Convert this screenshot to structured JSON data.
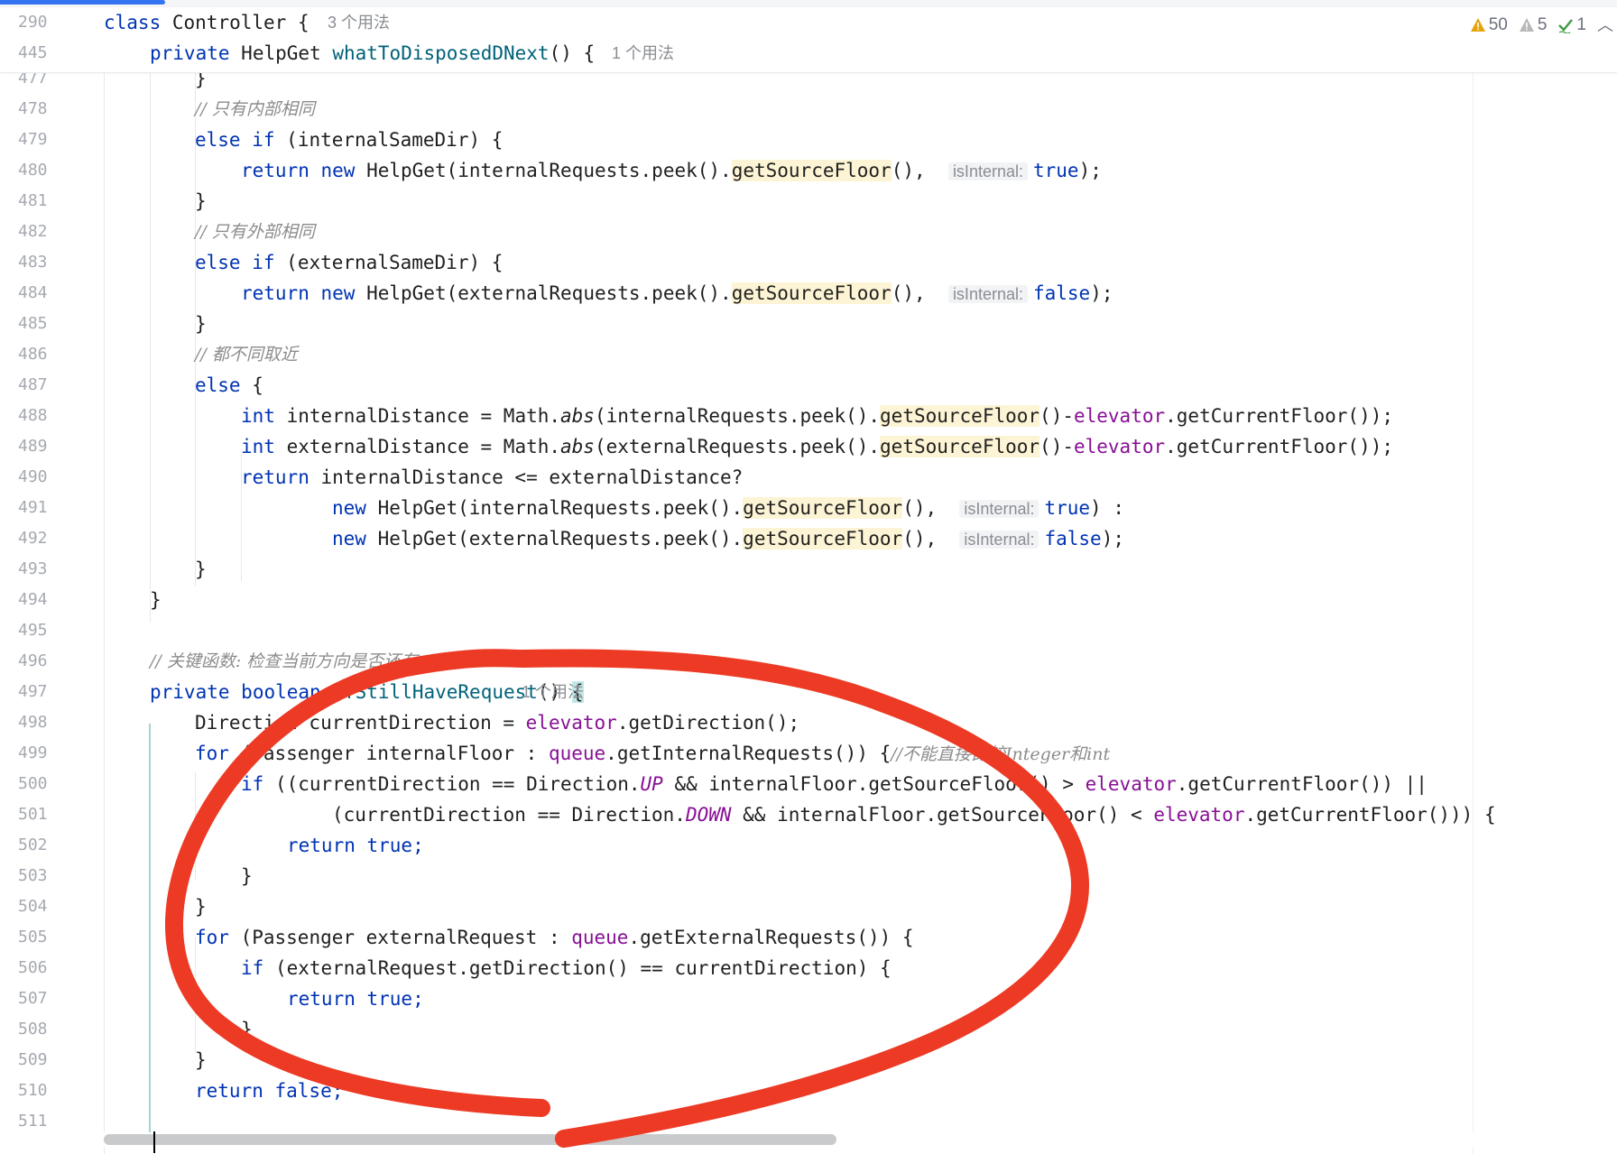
{
  "sticky": {
    "line1_num": "290",
    "line1_kw": "class",
    "line1_name": "Controller {",
    "line1_usage": "3 个用法",
    "line2_num": "445",
    "line2_kw": "private",
    "line2_type": "HelpGet",
    "line2_method": "whatToDisposedDNext",
    "line2_rest": "() {",
    "line2_usage": "1 个用法"
  },
  "inspections": {
    "warnings": "50",
    "weak_warnings": "5",
    "typos": "1",
    "warning_color": "#e5a50a",
    "weak_color": "#a8a8a8",
    "typo_color": "#3e9b45"
  },
  "lines": {
    "n477": "477",
    "n478": "478",
    "n479": "479",
    "n480": "480",
    "n481": "481",
    "n482": "482",
    "n483": "483",
    "n484": "484",
    "n485": "485",
    "n486": "486",
    "n487": "487",
    "n488": "488",
    "n489": "489",
    "n490": "490",
    "n491": "491",
    "n492": "492",
    "n493": "493",
    "n494": "494",
    "n495": "495",
    "n496": "496",
    "n497": "497",
    "n498": "498",
    "n499": "499",
    "n500": "500",
    "n501": "501",
    "n502": "502",
    "n503": "503",
    "n504": "504",
    "n505": "505",
    "n506": "506",
    "n507": "507",
    "n508": "508",
    "n509": "509",
    "n510": "510",
    "n511": "511"
  },
  "code": {
    "brace_close": "}",
    "c478": "// 只有内部相同",
    "else": "else",
    "if": "if",
    "internal_same": " (internalSameDir) {",
    "return": "return",
    "new": "new",
    "helpget_internal_peek": " HelpGet(internalRequests.peek().",
    "helpget_external_peek": " HelpGet(externalRequests.peek().",
    "get_source_floor": "getSourceFloor",
    "paren_comma": "(), ",
    "hint_is_internal": "isInternal:",
    "true": "true",
    "false": "false",
    "close_semicolon": ");",
    "c482": "// 只有外部相同",
    "external_same": " (externalSameDir) {",
    "c486": "// 都不同取近",
    "else_brace": " {",
    "int": "int",
    "int_dist_decl": " internalDistance = Math.",
    "ext_dist_decl": " externalDistance = Math.",
    "abs": "abs",
    "abs_internal": "(internalRequests.peek().",
    "abs_external": "(externalRequests.peek().",
    "minus": "()-",
    "elevator": "elevator",
    "get_current_floor_close": ".getCurrentFloor());",
    "ternary": " internalDistance <= externalDistance?",
    "ternary_colon": ") :",
    "c496": "// 关键函数: 检查当前方向是否还有",
    "private": "private",
    "boolean": "boolean",
    "if_still": "ifStillHaveRequest",
    "if_still_rest": "() ",
    "open_brace": "{",
    "usage_497": "1 个用法",
    "direction_decl": "Direction currentDirection = ",
    "get_direction": ".getDirection();",
    "for": "for",
    "for_internal": " (Passenger internalFloor : ",
    "queue": "queue",
    "get_internal_requests": ".getInternalRequests()) {",
    "c499": "//不能直接比较Integer和int",
    "if500_a": " ((currentDirection == Direction.",
    "up": "UP",
    "if500_b": " && internalFloor.getSourceFloor() > ",
    "get_current_floor_or": ".getCurrentFloor()) ||",
    "if501_a": "(currentDirection == Direction.",
    "down": "DOWN",
    "if501_b": " && internalFloor.getSourceFloor() < ",
    "get_current_floor_end": ".getCurrentFloor())) {",
    "true_semicolon": " true;",
    "for_external": " (Passenger externalRequest : ",
    "get_external_requests": ".getExternalRequests()) {",
    "if506": " (externalRequest.getDirection() == currentDirection) {",
    "false_semicolon": " false;"
  }
}
